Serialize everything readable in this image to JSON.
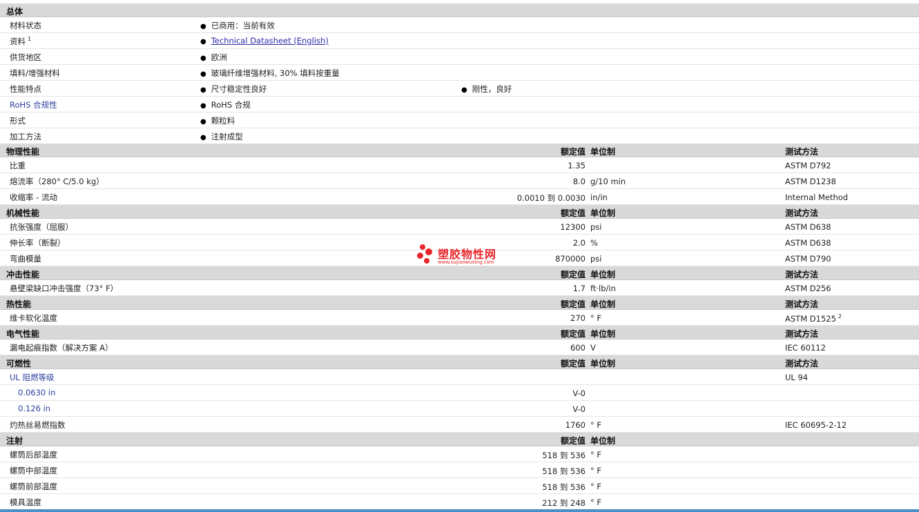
{
  "general": {
    "title": "总体",
    "material_status": {
      "label": "材料状态",
      "value": "已商用：当前有效"
    },
    "datasheet": {
      "label": "资料",
      "sup": "1",
      "link": "Technical Datasheet (English)"
    },
    "region": {
      "label": "供货地区",
      "value": "欧洲"
    },
    "filler": {
      "label": "填料/增强材料",
      "value": "玻璃纤维增强材料, 30% 填料按重量"
    },
    "features": {
      "label": "性能特点",
      "value1": "尺寸稳定性良好",
      "value2": "刚性，良好"
    },
    "rohs": {
      "label": "RoHS 合规性",
      "value": "RoHS 合规"
    },
    "form": {
      "label": "形式",
      "value": "颗粒料"
    },
    "process": {
      "label": "加工方法",
      "value": "注射成型"
    }
  },
  "headers": {
    "value": "额定值",
    "unit": "单位制",
    "method": "测试方法"
  },
  "physical": {
    "title": "物理性能",
    "rows": [
      {
        "label": "比重",
        "value": "1.35",
        "unit": "",
        "method": "ASTM D792"
      },
      {
        "label": "熔流率（280° C/5.0 kg）",
        "value": "8.0",
        "unit": "g/10 min",
        "method": "ASTM D1238"
      },
      {
        "label": "收缩率 - 流动",
        "value": "0.0010 到 0.0030",
        "unit": "in/in",
        "method": "Internal Method"
      }
    ]
  },
  "mechanical": {
    "title": "机械性能",
    "rows": [
      {
        "label": "抗张强度（屈服）",
        "value": "12300",
        "unit": "psi",
        "method": "ASTM D638"
      },
      {
        "label": "伸长率（断裂）",
        "value": "2.0",
        "unit": "%",
        "method": "ASTM D638"
      },
      {
        "label": "弯曲模量",
        "value": "870000",
        "unit": "psi",
        "method": "ASTM D790"
      }
    ]
  },
  "impact": {
    "title": "冲击性能",
    "rows": [
      {
        "label": "悬壁梁缺口冲击强度（73° F）",
        "value": "1.7",
        "unit": "ft·lb/in",
        "method": "ASTM D256"
      }
    ]
  },
  "thermal": {
    "title": "热性能",
    "rows": [
      {
        "label": "维卡软化温度",
        "value": "270",
        "unit": "° F",
        "method": "ASTM D1525",
        "method_sup": "2"
      }
    ]
  },
  "electrical": {
    "title": "电气性能",
    "rows": [
      {
        "label": "漏电起痕指数（解决方案 A）",
        "value": "600",
        "unit": "V",
        "method": "IEC 60112"
      }
    ]
  },
  "flammability": {
    "title": "可燃性",
    "rows": [
      {
        "label": "UL 阻燃等级",
        "value": "",
        "unit": "",
        "method": "UL 94"
      },
      {
        "label": "0.0630 in",
        "value": "V-0",
        "unit": "",
        "method": ""
      },
      {
        "label": "0.126 in",
        "value": "V-0",
        "unit": "",
        "method": ""
      },
      {
        "label": "灼热丝易燃指数",
        "value": "1760",
        "unit": "° F",
        "method": "IEC 60695-2-12"
      }
    ]
  },
  "injection": {
    "title": "注射",
    "rows": [
      {
        "label": "螺筒后部温度",
        "value": "518 到 536",
        "unit": "° F"
      },
      {
        "label": "螺筒中部温度",
        "value": "518 到 536",
        "unit": "° F"
      },
      {
        "label": "螺筒前部温度",
        "value": "518 到 536",
        "unit": "° F"
      },
      {
        "label": "模具温度",
        "value": "212 到 248",
        "unit": "° F"
      }
    ]
  },
  "watermark": {
    "text": "塑胶物性网",
    "url": "www.sujiaowuxing.com",
    "color": "#e8262a"
  }
}
